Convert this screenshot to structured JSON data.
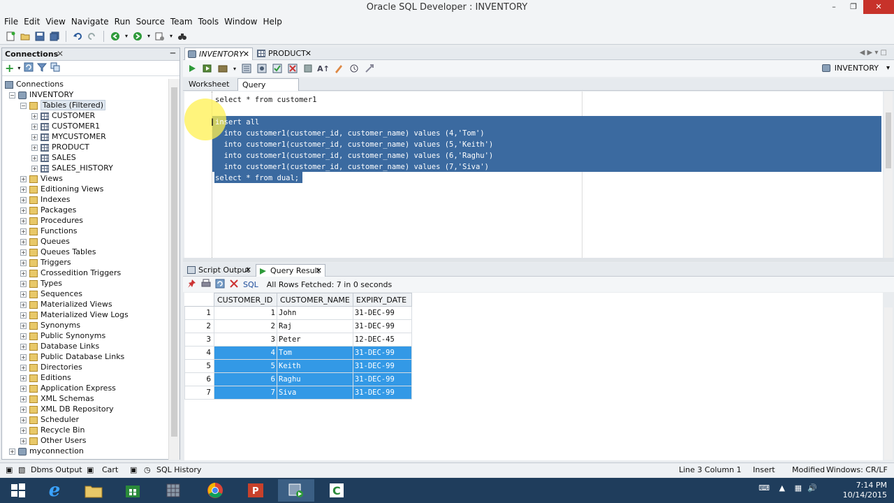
{
  "window": {
    "title": "Oracle SQL Developer : INVENTORY"
  },
  "menu": [
    "File",
    "Edit",
    "View",
    "Navigate",
    "Run",
    "Source",
    "Team",
    "Tools",
    "Window",
    "Help"
  ],
  "connections_panel": {
    "title": "Connections",
    "root": "Connections",
    "connection": "INVENTORY",
    "tables_folder": "Tables (Filtered)",
    "tables": [
      "CUSTOMER",
      "CUSTOMER1",
      "MYCUSTOMER",
      "PRODUCT",
      "SALES",
      "SALES_HISTORY"
    ],
    "folders": [
      "Views",
      "Editioning Views",
      "Indexes",
      "Packages",
      "Procedures",
      "Functions",
      "Queues",
      "Queues Tables",
      "Triggers",
      "Crossedition Triggers",
      "Types",
      "Sequences",
      "Materialized Views",
      "Materialized View Logs",
      "Synonyms",
      "Public Synonyms",
      "Database Links",
      "Public Database Links",
      "Directories",
      "Editions",
      "Application Express",
      "XML Schemas",
      "XML DB Repository",
      "Scheduler",
      "Recycle Bin",
      "Other Users"
    ],
    "other_connection": "myconnection"
  },
  "editor_tabs": [
    "INVENTORY",
    "PRODUCT"
  ],
  "connection_selector": "INVENTORY",
  "sub_tabs": [
    "Worksheet",
    "Query Builder"
  ],
  "code_lines": [
    "select * from customer1",
    "",
    "insert all",
    "  into customer1(customer_id, customer_name) values (4,'Tom')",
    "  into customer1(customer_id, customer_name) values (5,'Keith')",
    "  into customer1(customer_id, customer_name) values (6,'Raghu')",
    "  into customer1(customer_id, customer_name) values (7,'Siva')",
    "select * from dual;"
  ],
  "result_tabs": [
    "Script Output",
    "Query Result"
  ],
  "result_toolbar": {
    "sql_label": "SQL",
    "status": "All Rows Fetched: 7 in 0 seconds"
  },
  "result_grid": {
    "columns": [
      "CUSTOMER_ID",
      "CUSTOMER_NAME",
      "EXPIRY_DATE"
    ],
    "rows": [
      [
        "1",
        "1",
        "John",
        "31-DEC-99"
      ],
      [
        "2",
        "2",
        "Raj",
        "31-DEC-99"
      ],
      [
        "3",
        "3",
        "Peter",
        "12-DEC-45"
      ],
      [
        "4",
        "4",
        "Tom",
        "31-DEC-99"
      ],
      [
        "5",
        "5",
        "Keith",
        "31-DEC-99"
      ],
      [
        "6",
        "6",
        "Raghu",
        "31-DEC-99"
      ],
      [
        "7",
        "7",
        "Siva",
        "31-DEC-99"
      ]
    ],
    "selected_rows": [
      4,
      5,
      6,
      7
    ]
  },
  "dock": {
    "dbms_output": "Dbms Output",
    "cart": "Cart",
    "sql_history": "SQL History"
  },
  "statusbar": {
    "position": "Line 3 Column 1",
    "mode": "Insert",
    "modified": "Modified",
    "line_ending": "Windows: CR/LF"
  },
  "taskbar": {
    "time": "7:14 PM",
    "date": "10/14/2015"
  },
  "colors": {
    "selection": "#3b6aa0",
    "grid_selection": "#3399e6",
    "taskbar": "#1f3d5c"
  }
}
